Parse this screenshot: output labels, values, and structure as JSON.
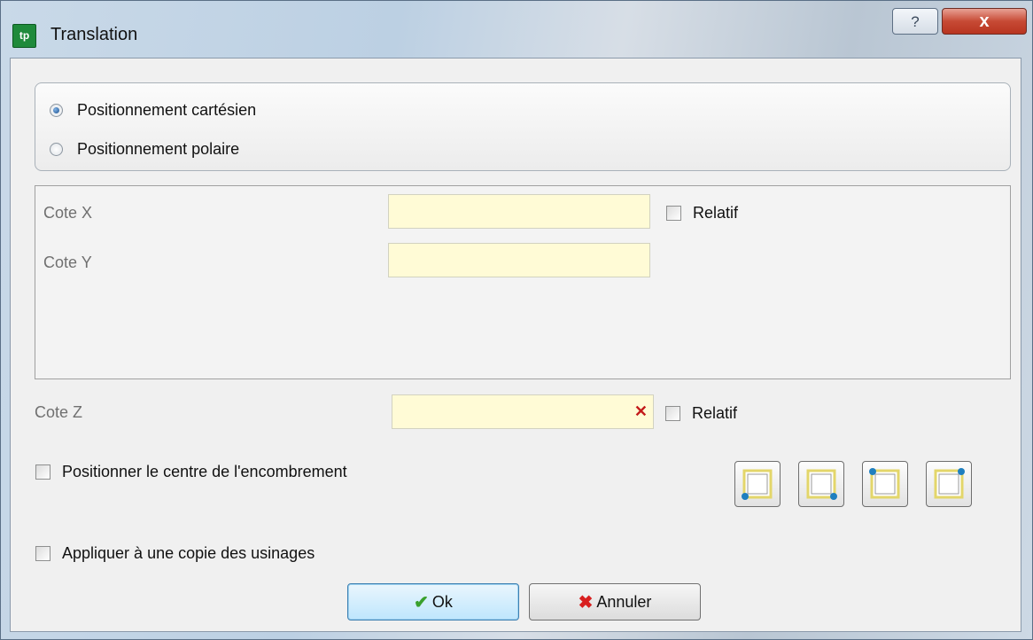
{
  "window": {
    "title": "Translation",
    "app_icon_text": "tp",
    "help_glyph": "?",
    "close_glyph": "x"
  },
  "mode": {
    "options": [
      {
        "label": "Positionnement cartésien",
        "checked": true
      },
      {
        "label": "Positionnement polaire",
        "checked": false
      }
    ]
  },
  "coords": {
    "x_label": "Cote X",
    "x_value": "",
    "x_relative_label": "Relatif",
    "x_relative_checked": false,
    "y_label": "Cote Y",
    "y_value": ""
  },
  "z": {
    "label": "Cote Z",
    "value": "",
    "clear_glyph": "✕",
    "relative_label": "Relatif",
    "relative_checked": false
  },
  "options": {
    "center_label": "Positionner le centre de l'encombrement",
    "center_checked": false,
    "copy_label": "Appliquer à une copie des usinages",
    "copy_checked": false
  },
  "corner_buttons": [
    "bottom-left",
    "bottom-right",
    "top-left",
    "top-right"
  ],
  "buttons": {
    "ok_label": "Ok",
    "cancel_label": "Annuler"
  },
  "colors": {
    "input_background": "#fffbd6",
    "corner_frame": "#e3d66a",
    "corner_dot": "#1f7fbf"
  }
}
